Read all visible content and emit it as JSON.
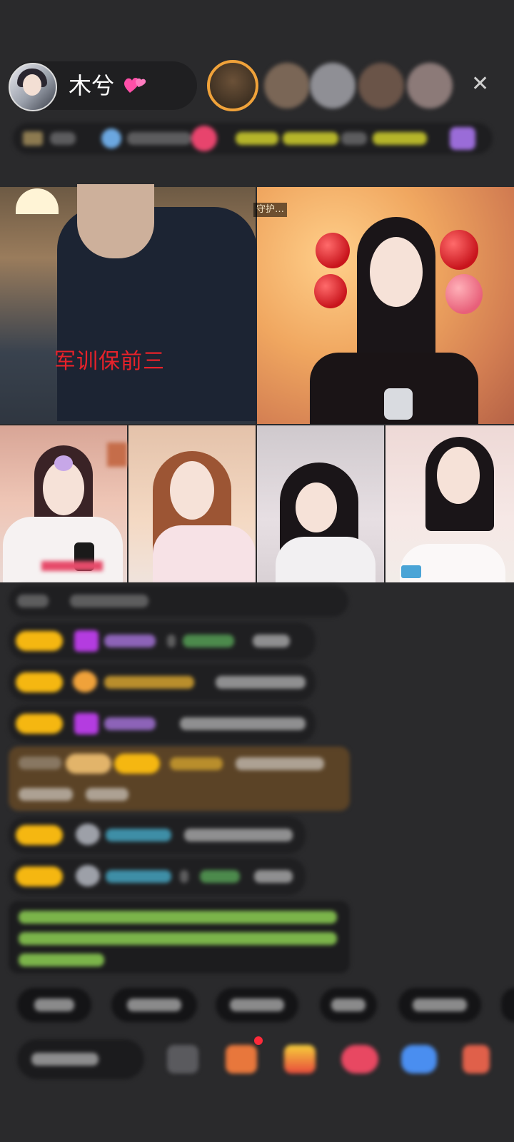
{
  "header": {
    "host_name": "木兮",
    "heart_icon": "two-hearts-icon",
    "close_icon": "close-icon"
  },
  "video": {
    "overlay_text": "军训保前三",
    "guard_tag": "守护…"
  },
  "colors": {
    "badge_yellow": "#f5b711",
    "accent_orange": "#f0a23a",
    "highlight_brown": "#5b4326",
    "overlay_red": "#e8222a"
  }
}
